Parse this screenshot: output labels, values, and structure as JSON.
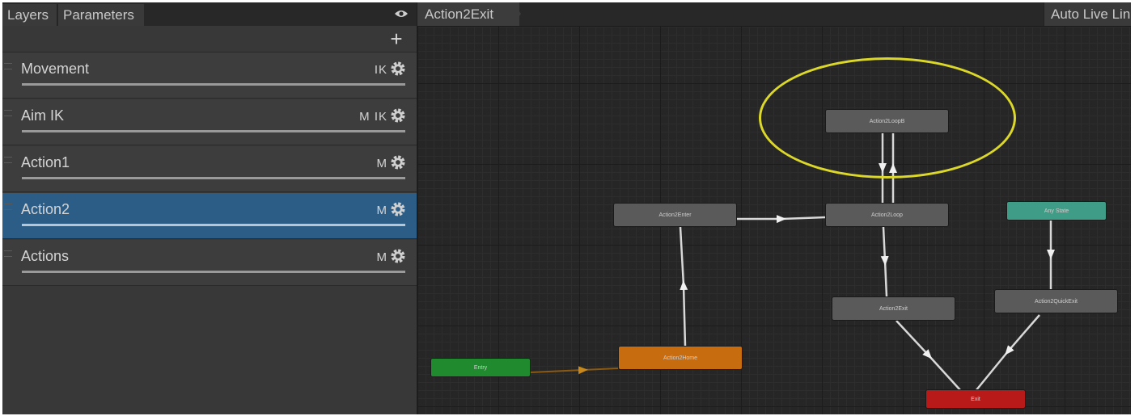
{
  "tabs": {
    "layers": "Layers",
    "parameters": "Parameters"
  },
  "layers": [
    {
      "name": "Movement",
      "flags": "IK",
      "selected": false
    },
    {
      "name": "Aim IK",
      "flags": "M IK",
      "selected": false
    },
    {
      "name": "Action1",
      "flags": "M",
      "selected": false
    },
    {
      "name": "Action2",
      "flags": "M",
      "selected": true
    },
    {
      "name": "Actions",
      "flags": "M",
      "selected": false
    }
  ],
  "graph": {
    "breadcrumb": "Action2Exit",
    "auto_live_link": "Auto Live Lin",
    "states": {
      "loop_b": "Action2LoopB",
      "enter": "Action2Enter",
      "loop": "Action2Loop",
      "any_state": "Any State",
      "exit_state": "Action2Exit",
      "quick_exit": "Action2QuickExit",
      "entry": "Entry",
      "home": "Action2Home",
      "exit": "Exit"
    }
  },
  "colors": {
    "selection": "#2c5d87",
    "highlight_ring": "#dcd82a",
    "entry": "#1f8a2e",
    "default_state": "#c86c10",
    "any_state": "#3f9c86",
    "exit": "#b81a1a"
  }
}
